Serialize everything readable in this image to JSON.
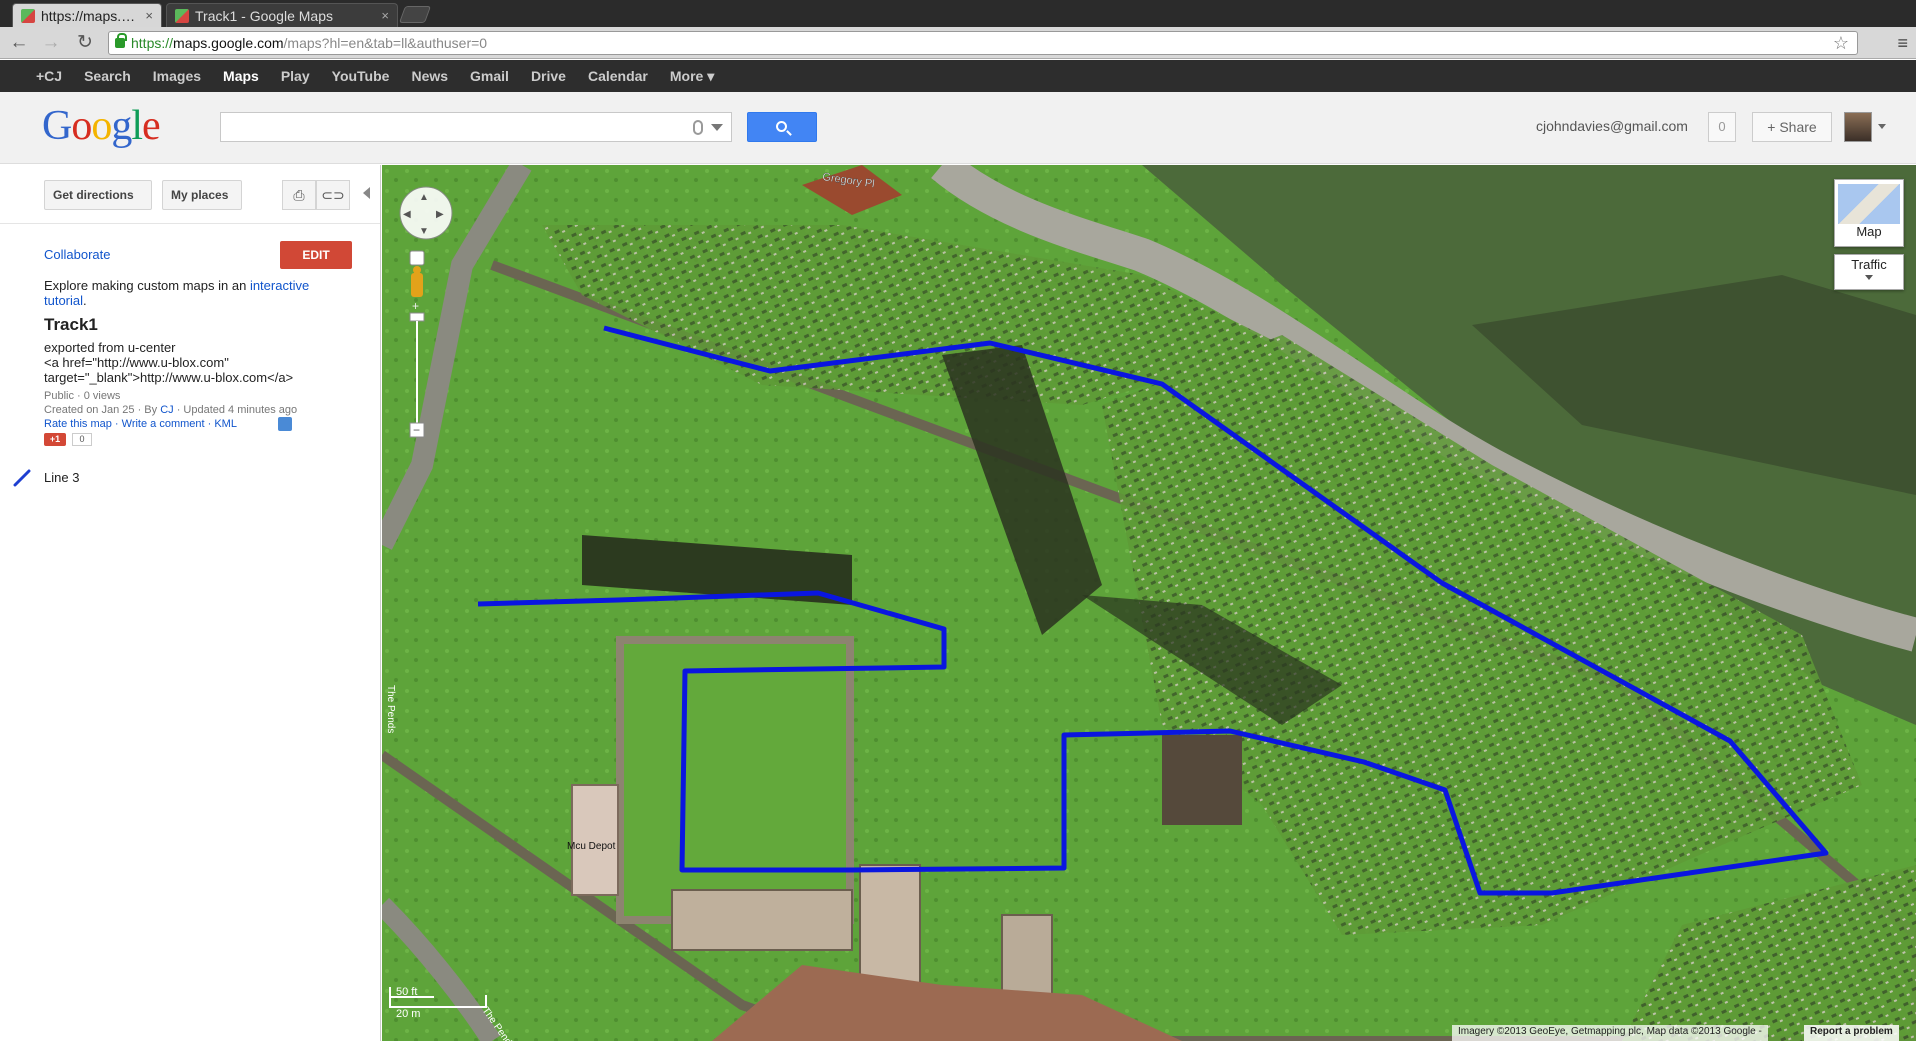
{
  "browser": {
    "tabs": [
      {
        "title": "https://maps.google.c",
        "close": "×"
      },
      {
        "title": "Track1 - Google Maps",
        "close": "×"
      }
    ],
    "url_scheme": "https://",
    "url_host": "maps.google.com",
    "url_path": "/maps?hl=en&tab=ll&authuser=0"
  },
  "gbar": {
    "items": [
      "+CJ",
      "Search",
      "Images",
      "Maps",
      "Play",
      "YouTube",
      "News",
      "Gmail",
      "Drive",
      "Calendar",
      "More ▾"
    ],
    "active": "Maps"
  },
  "header": {
    "logo": [
      "G",
      "o",
      "o",
      "g",
      "l",
      "e"
    ],
    "search_value": "",
    "email": "cjohndavies@gmail.com",
    "notifications": "0",
    "share_label": "+ Share"
  },
  "panel": {
    "get_directions": "Get directions",
    "my_places": "My places",
    "collaborate": "Collaborate",
    "edit": "EDIT",
    "explore_text": "Explore making custom maps in an ",
    "explore_link": "interactive tutorial",
    "explore_end": ".",
    "title": "Track1",
    "description": "exported from u-center\n<a href=\"http://www.u-blox.com\" target=\"_blank\">http://www.u-blox.com</a>",
    "meta1": "Public · 0 views",
    "meta2_pre": "Created on Jan 25 · By ",
    "meta2_by": "CJ",
    "meta2_post": " · Updated 4 minutes ago",
    "links": "Rate this map · Write a comment · KML",
    "plus1": "+1",
    "plus_count": "0",
    "line_label": "Line 3",
    "line_color": "#1e3fd1"
  },
  "map": {
    "type_label": "Map",
    "traffic_label": "Traffic",
    "scale_ft": "50 ft",
    "scale_m": "20 m",
    "attribution": "Imagery ©2013 GeoEye, Getmapping plc, Map data ©2013 Google -",
    "report": "Report a problem",
    "street_labels": [
      "Gregory Pl",
      "The Pends",
      "Mcu Depot",
      "The Pends"
    ],
    "track_color": "#0a16e0"
  }
}
